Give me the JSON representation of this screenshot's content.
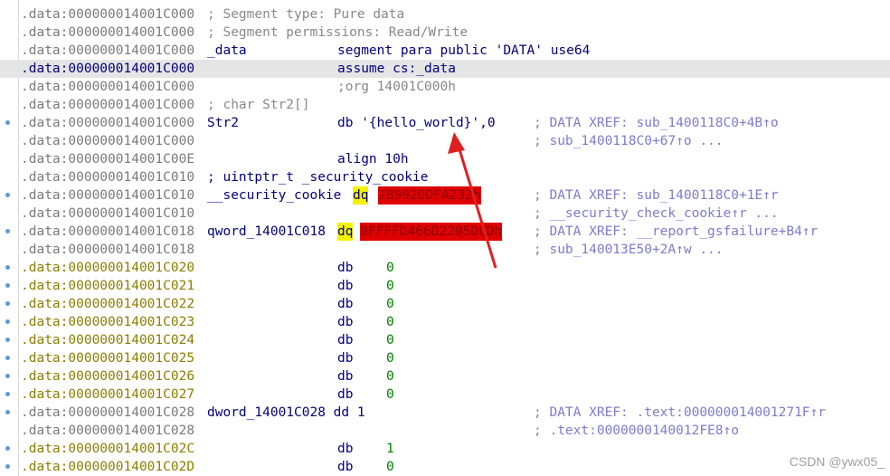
{
  "lines": [
    {
      "addr": ".data:000000014001C000",
      "cmt": "; Segment type: Pure data"
    },
    {
      "addr": ".data:000000014001C000",
      "cmt": "; Segment permissions: Read/Write"
    },
    {
      "addr": ".data:000000014001C000",
      "name": "_data",
      "instr": "segment para public 'DATA' use64"
    },
    {
      "addr": ".data:000000014001C000",
      "instr": "assume cs:_data",
      "highlight": true
    },
    {
      "addr": ".data:000000014001C000",
      "instr": ";org 14001C000h",
      "instr_cmt": true
    },
    {
      "addr": ".data:000000014001C000",
      "cmt": "; char Str2[]"
    },
    {
      "addr": ".data:000000014001C000",
      "name": "Str2",
      "instr": "db '{hello_world}',0",
      "xref": "; DATA XREF: sub_1400118C0+4B↑o",
      "dot": true
    },
    {
      "addr": ".data:000000014001C000",
      "xref": "; sub_1400118C0+67↑o ..."
    },
    {
      "addr": ".data:000000014001C00E",
      "instr": "align 10h"
    },
    {
      "addr": ".data:000000014001C010",
      "name": "; uintptr_t _security_cookie"
    },
    {
      "addr": ".data:000000014001C010",
      "name": "__security_cookie",
      "op": "dq",
      "val": "2B992DDFA232h",
      "xref": "; DATA XREF: sub_1400118C0+1E↑r",
      "dot": true
    },
    {
      "addr": ".data:000000014001C010",
      "xref": "; __security_check_cookie↑r ..."
    },
    {
      "addr": ".data:000000014001C018",
      "name": "qword_14001C018",
      "op": "dq",
      "val": "0FFFFD466D2205DCDh",
      "xref": "; DATA XREF: __report_gsfailure+B4↑r",
      "dot": true
    },
    {
      "addr": ".data:000000014001C018",
      "xref": "; sub_140013E50+2A↑w ..."
    },
    {
      "addr": ".data:000000014001C020",
      "instr": "db",
      "num": "0",
      "dot": true,
      "label": true
    },
    {
      "addr": ".data:000000014001C021",
      "instr": "db",
      "num": "0",
      "dot": true,
      "label": true
    },
    {
      "addr": ".data:000000014001C022",
      "instr": "db",
      "num": "0",
      "dot": true,
      "label": true
    },
    {
      "addr": ".data:000000014001C023",
      "instr": "db",
      "num": "0",
      "dot": true,
      "label": true
    },
    {
      "addr": ".data:000000014001C024",
      "instr": "db",
      "num": "0",
      "dot": true,
      "label": true
    },
    {
      "addr": ".data:000000014001C025",
      "instr": "db",
      "num": "0",
      "dot": true,
      "label": true
    },
    {
      "addr": ".data:000000014001C026",
      "instr": "db",
      "num": "0",
      "dot": true,
      "label": true
    },
    {
      "addr": ".data:000000014001C027",
      "instr": "db",
      "num": "0",
      "dot": true,
      "label": true
    },
    {
      "addr": ".data:000000014001C028",
      "name": "dword_14001C028 dd 1",
      "xref": "; DATA XREF: .text:000000014001271F↑r",
      "dot": true
    },
    {
      "addr": ".data:000000014001C028",
      "xref": "; .text:0000000140012FE8↑o"
    },
    {
      "addr": ".data:000000014001C02C",
      "instr": "db",
      "num": "1",
      "dot": true,
      "label": true
    },
    {
      "addr": ".data:000000014001C02D",
      "instr": "db",
      "num": "0",
      "dot": true,
      "label": true
    }
  ],
  "watermark": "CSDN @ywx05_",
  "colors": {
    "highlight_row": "#e5e5e5",
    "keyword_highlight": "#f3f300",
    "value_highlight": "#e00000",
    "arrow": "#e02020"
  }
}
